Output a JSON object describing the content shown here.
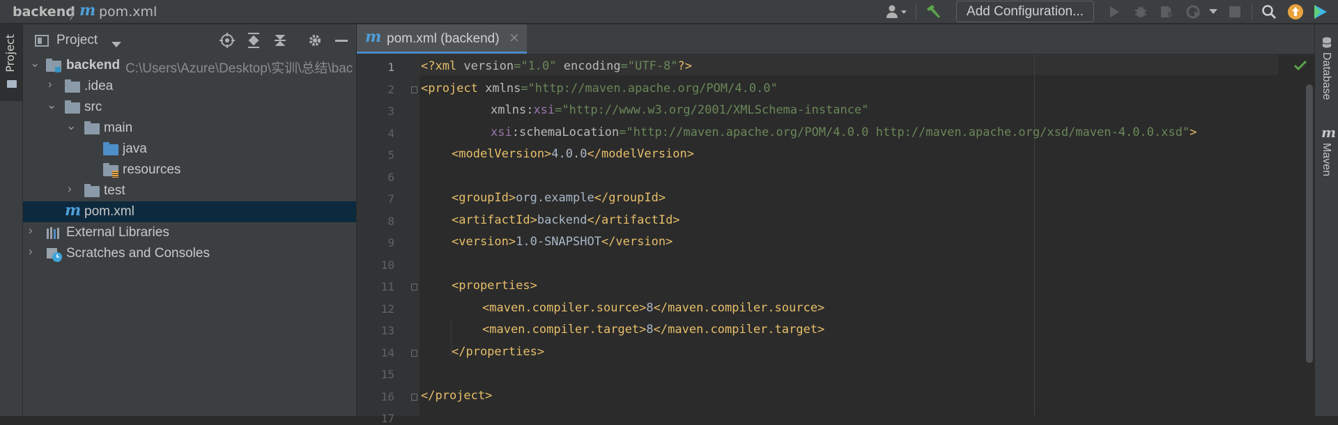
{
  "breadcrumb": {
    "project": "backend",
    "separator": "〉",
    "file_icon": "m",
    "file": "pom.xml"
  },
  "toolbar": {
    "add_configuration_label": "Add Configuration...",
    "icons": [
      "user-icon",
      "hammer-icon",
      "run-icon",
      "debug-icon",
      "coverage-icon",
      "profile-icon",
      "stop-icon",
      "search-icon",
      "update-icon",
      "toolbox-icon"
    ],
    "accent_color": "#e8a33d"
  },
  "left_strip": {
    "project_label": "Project"
  },
  "project_panel": {
    "title": "Project",
    "tree": [
      {
        "label": "backend",
        "path": "C:\\Users\\Azure\\Desktop\\实训\\总结\\bac",
        "expanded": true
      },
      {
        "label": ".idea",
        "expanded": false
      },
      {
        "label": "src",
        "expanded": true
      },
      {
        "label": "main",
        "expanded": true
      },
      {
        "label": "java"
      },
      {
        "label": "resources"
      },
      {
        "label": "test",
        "expanded": false
      },
      {
        "label": "pom.xml",
        "selected": true
      },
      {
        "label": "External Libraries",
        "expanded": false
      },
      {
        "label": "Scratches and Consoles",
        "expanded": false
      }
    ]
  },
  "editor": {
    "tab_label": "pom.xml (backend)",
    "tab_close": "×",
    "current_line": 1,
    "line_numbers": [
      "1",
      "2",
      "3",
      "4",
      "5",
      "6",
      "7",
      "8",
      "9",
      "10",
      "11",
      "12",
      "13",
      "14",
      "15",
      "16",
      "17"
    ],
    "lines": {
      "l1": {
        "decl_open": "<?xml ",
        "version_attr": "version",
        "eq1": "=",
        "version_val": "\"1.0\"",
        "encoding_attr": " encoding",
        "eq2": "=",
        "encoding_val": "\"UTF-8\"",
        "decl_close": "?>"
      },
      "l2": {
        "tag": "<project",
        "attr": " xmlns",
        "eq": "=",
        "val": "\"http://maven.apache.org/POM/4.0.0\""
      },
      "l3": {
        "attr": "xmlns",
        "colon": ":",
        "ns": "xsi",
        "eq": "=",
        "val": "\"http://www.w3.org/2001/XMLSchema-instance\""
      },
      "l4": {
        "ns": "xsi",
        "colon": ":",
        "attr": "schemaLocation",
        "eq": "=",
        "val": "\"http://maven.apache.org/POM/4.0.0 http://maven.apache.org/xsd/maven-4.0.0.xsd\"",
        "close": ">"
      },
      "l5": {
        "open": "<modelVersion>",
        "text": "4.0.0",
        "close": "</modelVersion>"
      },
      "l7": {
        "open": "<groupId>",
        "text": "org.example",
        "close": "</groupId>"
      },
      "l8": {
        "open": "<artifactId>",
        "text": "backend",
        "close": "</artifactId>"
      },
      "l9": {
        "open": "<version>",
        "text": "1.0-SNAPSHOT",
        "close": "</version>"
      },
      "l11": {
        "open": "<properties>"
      },
      "l12": {
        "open": "<maven.compiler.source>",
        "text": "8",
        "close": "</maven.compiler.source>"
      },
      "l13": {
        "open": "<maven.compiler.target>",
        "text": "8",
        "close": "</maven.compiler.target>"
      },
      "l14": {
        "close": "</properties>"
      },
      "l16": {
        "close": "</project>"
      }
    }
  },
  "right_strip": {
    "database_label": "Database",
    "maven_label": "Maven"
  }
}
